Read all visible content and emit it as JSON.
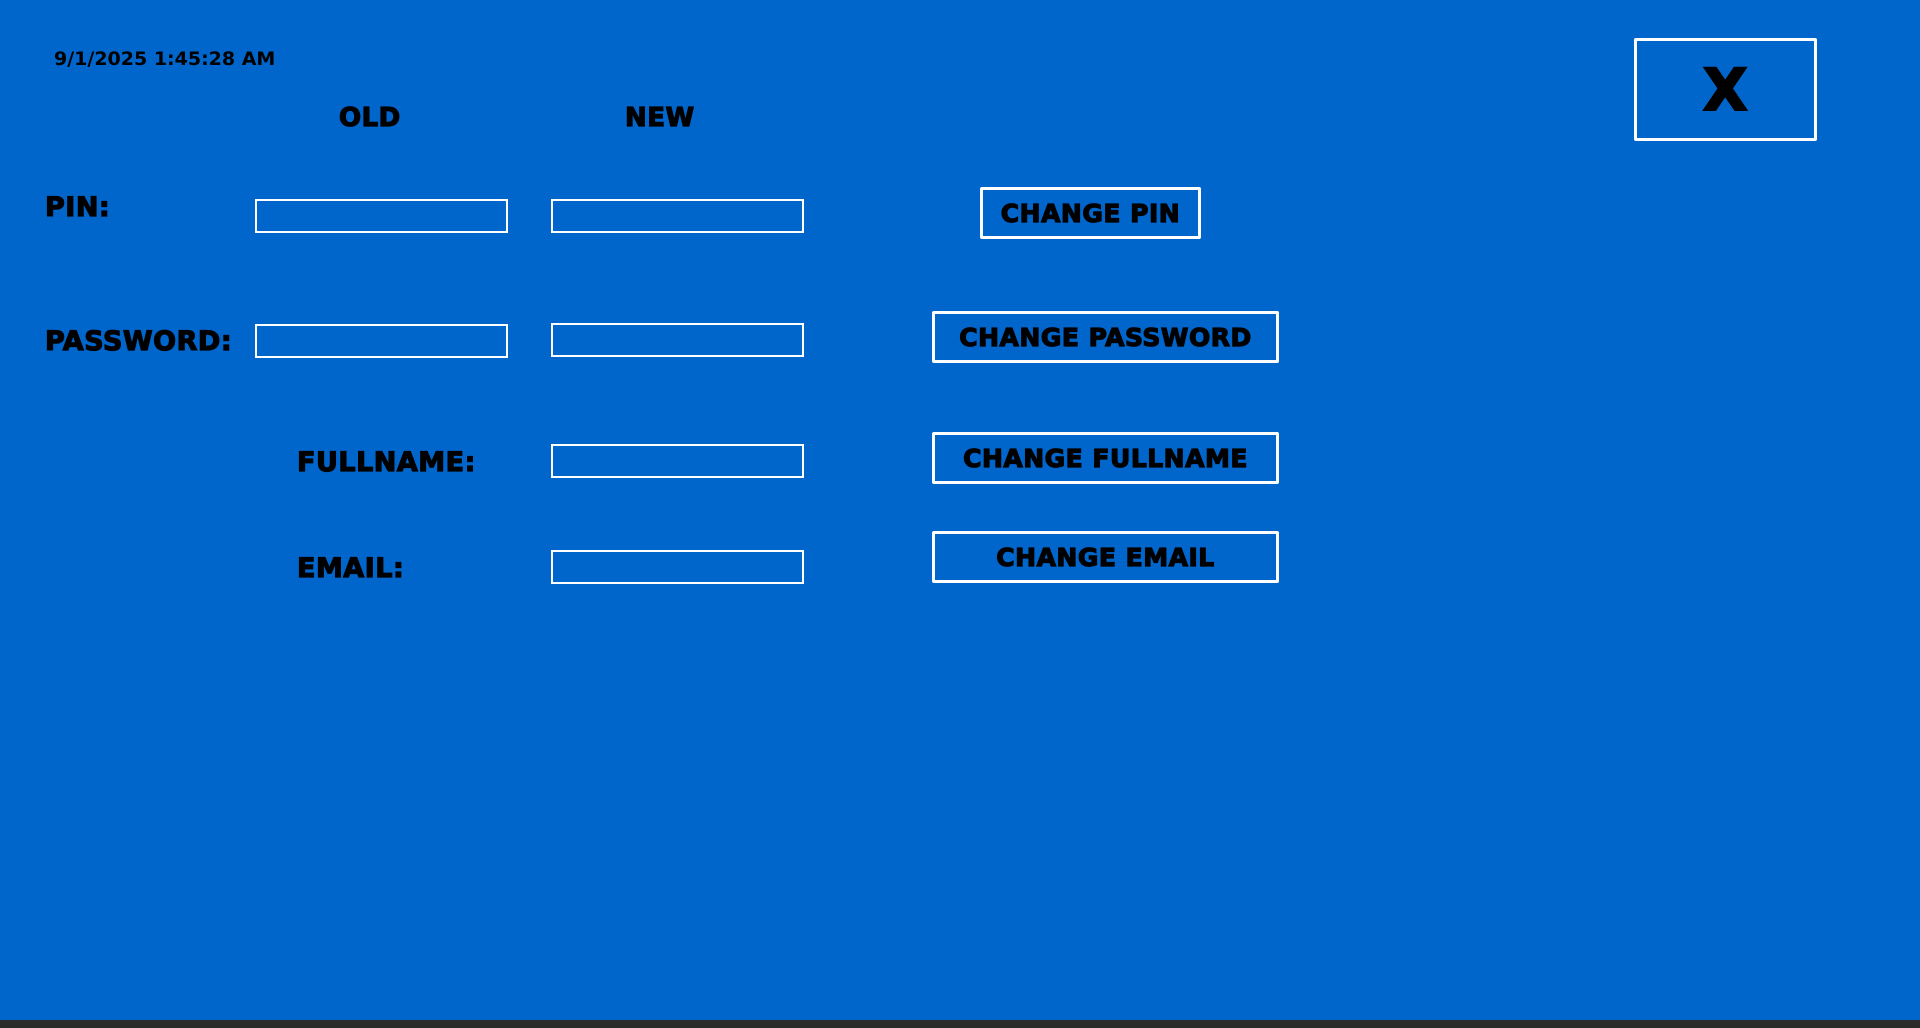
{
  "header": {
    "timestamp": "9/1/2025 1:45:28 AM",
    "close_label": "X"
  },
  "columns": {
    "old": "OLD",
    "new": "NEW"
  },
  "pin": {
    "label": "PIN:",
    "old_value": "",
    "new_value": "",
    "button": "CHANGE PIN"
  },
  "password": {
    "label": "PASSWORD:",
    "old_value": "",
    "new_value": "",
    "button": "CHANGE PASSWORD"
  },
  "fullname": {
    "label": "FULLNAME:",
    "new_value": "",
    "button": "CHANGE FULLNAME"
  },
  "email": {
    "label": "EMAIL:",
    "new_value": "",
    "button": "CHANGE EMAIL"
  },
  "colors": {
    "background": "#0066cc",
    "border": "#ffffff",
    "text": "#000000"
  }
}
